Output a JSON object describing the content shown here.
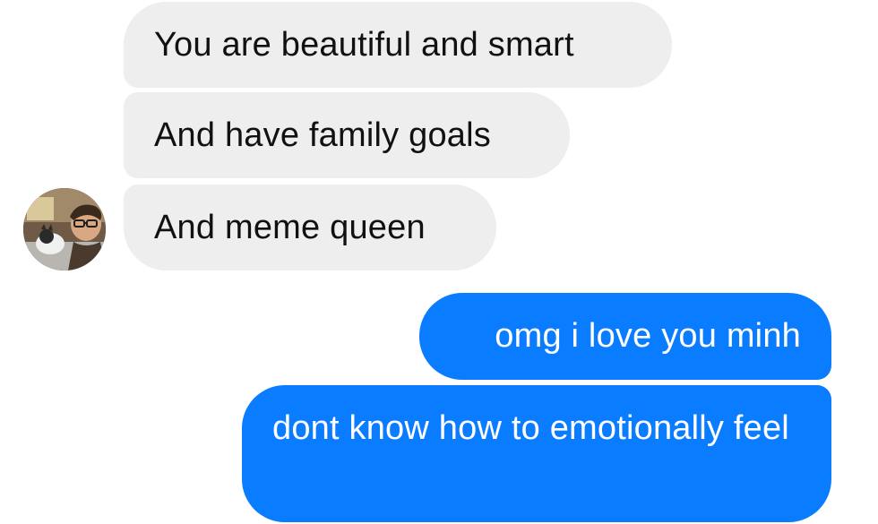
{
  "conversation": {
    "contact": {
      "avatar": "contact-photo"
    },
    "incoming_messages": [
      {
        "text": "You are beautiful and smart"
      },
      {
        "text": "And have family goals"
      },
      {
        "text": "And meme queen"
      }
    ],
    "outgoing_messages": [
      {
        "text": "omg i love you minh"
      },
      {
        "text": "dont know how to emotionally feel"
      }
    ]
  },
  "colors": {
    "incoming_bubble": "#eeeeef",
    "incoming_text": "#111111",
    "outgoing_bubble": "#0a7cff",
    "outgoing_text": "#ffffff",
    "background": "#ffffff"
  }
}
